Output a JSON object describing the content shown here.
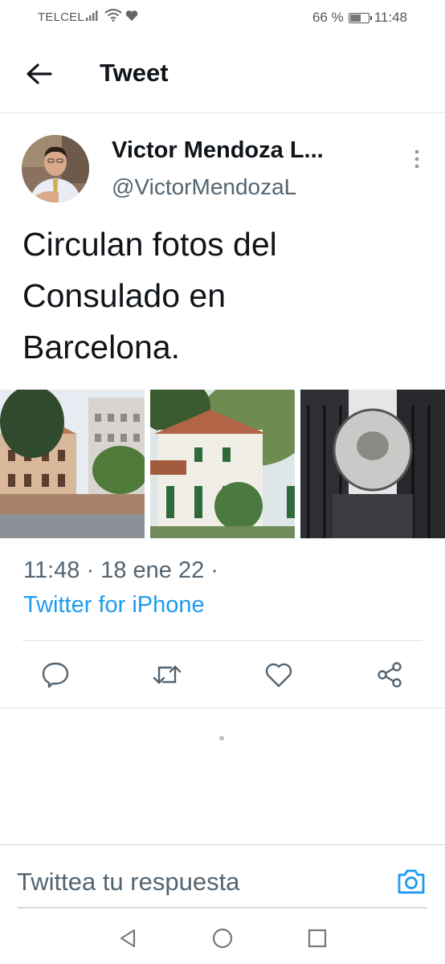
{
  "status_bar": {
    "carrier": "TELCEL",
    "battery_text": "66 %",
    "battery_level": 0.66,
    "time": "11:48"
  },
  "header": {
    "title": "Tweet",
    "back_icon": "arrow-left-icon"
  },
  "tweet": {
    "author_name": "Victor Mendoza L...",
    "author_handle": "@VictorMendozaL",
    "text_lines": [
      "Circulan fotos del",
      "Consulado en",
      "Barcelona."
    ],
    "media_count": 3,
    "timestamp": "11:48 · 18 ene 22 ·",
    "source": "Twitter for iPhone"
  },
  "actions": [
    {
      "name": "reply",
      "icon": "reply-icon"
    },
    {
      "name": "retweet",
      "icon": "retweet-icon"
    },
    {
      "name": "like",
      "icon": "heart-icon"
    },
    {
      "name": "share",
      "icon": "share-icon"
    }
  ],
  "reply_bar": {
    "placeholder": "Twittea tu respuesta",
    "camera_icon": "camera-icon"
  },
  "colors": {
    "accent": "#1d9bf0",
    "secondary_text": "#536471",
    "divider": "#dfe3e6"
  }
}
